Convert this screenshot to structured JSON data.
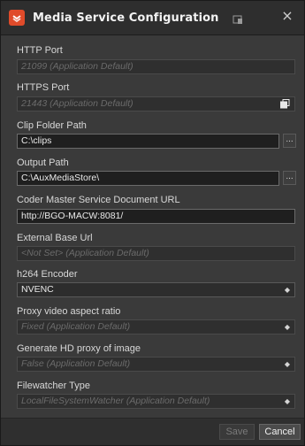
{
  "window": {
    "title": "Media Service Configuration",
    "close_label": "×",
    "icons": {
      "app": "media-service-logo-icon",
      "mid": "window-pin-icon",
      "close": "close-icon",
      "copy": "copy-icon",
      "dropdown": "chevron-up-down-icon"
    },
    "colors": {
      "accent": "#e04b2a",
      "background": "#3a3a3a",
      "input_bg": "#2d2d2d",
      "disabled_text": "#6b6b6b"
    }
  },
  "fields": {
    "http_port": {
      "label": "HTTP Port",
      "value": "",
      "placeholder": "21099 (Application Default)"
    },
    "https_port": {
      "label": "HTTPS Port",
      "value": "",
      "placeholder": "21443 (Application Default)"
    },
    "clip_folder_path": {
      "label": "Clip Folder Path",
      "value": "C:\\clips",
      "browse_label": "..."
    },
    "output_path": {
      "label": "Output Path",
      "value": "C:\\AuxMediaStore\\",
      "browse_label": "..."
    },
    "coder_master_url": {
      "label": "Coder Master Service Document URL",
      "value": "http://BGO-MACW:8081/"
    },
    "external_base_url": {
      "label": "External Base Url",
      "value": "",
      "placeholder": "<Not Set> (Application Default)"
    },
    "h264_encoder": {
      "label": "h264 Encoder",
      "selected": "NVENC"
    },
    "proxy_aspect_ratio": {
      "label": "Proxy video aspect ratio",
      "selected": "Fixed (Application Default)"
    },
    "hd_proxy": {
      "label": "Generate HD proxy of image",
      "selected": "False (Application Default)"
    },
    "filewatcher_type": {
      "label": "Filewatcher Type",
      "selected": "LocalFileSystemWatcher (Application Default)"
    }
  },
  "footer": {
    "save_label": "Save",
    "cancel_label": "Cancel"
  }
}
